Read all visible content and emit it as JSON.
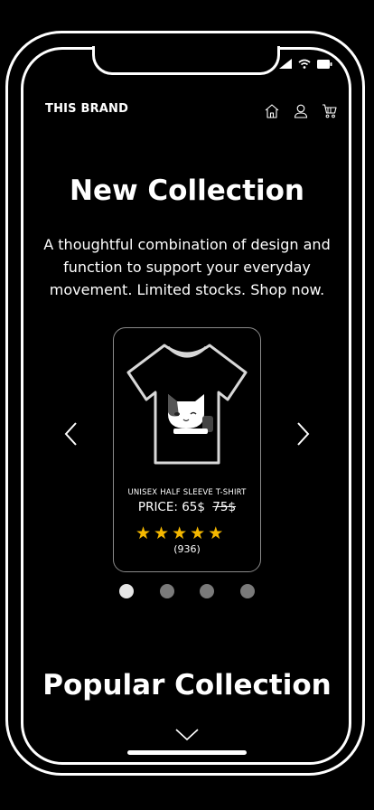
{
  "header": {
    "brand": "THIS BRAND",
    "icons": [
      "home-icon",
      "user-icon",
      "cart-icon"
    ]
  },
  "status_bar": {
    "icons": [
      "signal-icon",
      "wifi-icon",
      "battery-icon"
    ]
  },
  "hero": {
    "title": "New Collection",
    "subtitle": "A thoughtful combination of design and function to support your everyday movement. Limited stocks. Shop now."
  },
  "product": {
    "name": "UNISEX HALF SLEEVE T-SHIRT",
    "price_label": "PRICE: 65$",
    "old_price": "75$",
    "rating": 5,
    "review_count": "(936)",
    "image": "t-shirt-with-cat-print"
  },
  "carousel": {
    "dots": 4,
    "active_index": 0
  },
  "popular": {
    "title": "Popular Collection"
  },
  "colors": {
    "background": "#000000",
    "foreground": "#ffffff",
    "star": "#f5b800",
    "dot_active": "#e6e6e6",
    "dot_inactive": "#7a7a7a"
  }
}
